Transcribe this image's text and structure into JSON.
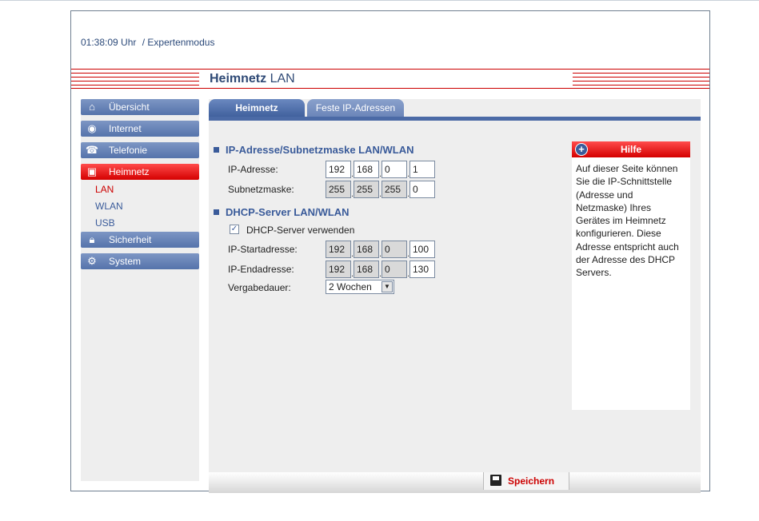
{
  "header": {
    "time": "01:38:09 Uhr",
    "mode": "/ Expertenmodus"
  },
  "page_title": {
    "bold": "Heimnetz",
    "rest": "LAN"
  },
  "sidebar": {
    "items": [
      {
        "label": "Übersicht",
        "icon": "home-icon"
      },
      {
        "label": "Internet",
        "icon": "globe-icon"
      },
      {
        "label": "Telefonie",
        "icon": "phone-icon"
      },
      {
        "label": "Heimnetz",
        "icon": "network-icon"
      },
      {
        "label": "Sicherheit",
        "icon": "lock-icon"
      },
      {
        "label": "System",
        "icon": "gears-icon"
      }
    ],
    "subitems": [
      "LAN",
      "WLAN",
      "USB"
    ]
  },
  "tabs": [
    "Heimnetz",
    "Feste IP-Adressen"
  ],
  "section1": {
    "title": "IP-Adresse/Subnetzmaske LAN/WLAN",
    "ip_label": "IP-Adresse:",
    "ip": [
      "192",
      "168",
      "0",
      "1"
    ],
    "mask_label": "Subnetzmaske:",
    "mask": [
      "255",
      "255",
      "255",
      "0"
    ]
  },
  "section2": {
    "title": "DHCP-Server LAN/WLAN",
    "dhcp_check_label": "DHCP-Server verwenden",
    "dhcp_checked": true,
    "start_label": "IP-Startadresse:",
    "start": [
      "192",
      "168",
      "0",
      "100"
    ],
    "end_label": "IP-Endadresse:",
    "end": [
      "192",
      "168",
      "0",
      "130"
    ],
    "lease_label": "Vergabedauer:",
    "lease_value": "2 Wochen"
  },
  "help": {
    "title": "Hilfe",
    "text": "Auf dieser Seite können Sie die IP-Schnittstelle (Adresse und Netzmaske) Ihres Gerätes im Heimnetz konfigurieren. Diese Adresse entspricht auch der Adresse des DHCP Servers."
  },
  "footer": {
    "save_label": "Speichern"
  },
  "colors": {
    "accent_red": "#d40000",
    "nav_blue": "#5573ab",
    "text_blue": "#3a5b9a"
  }
}
